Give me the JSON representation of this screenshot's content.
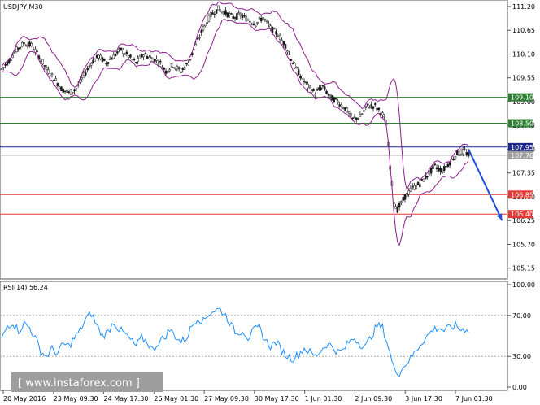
{
  "chart_data": [
    {
      "type": "candlestick",
      "title": "USDJPY,M30",
      "ylim": [
        104.9,
        111.35
      ],
      "price_ticks": [
        "111.20",
        "110.65",
        "110.10",
        "109.55",
        "109.00",
        "108.45",
        "107.90",
        "107.35",
        "106.80",
        "106.25",
        "105.70",
        "105.15"
      ],
      "x_tick_labels": [
        "20 May 2016",
        "23 May 09:30",
        "24 May 17:30",
        "26 May 01:30",
        "27 May 09:30",
        "30 May 17:30",
        "1 Jun 01:30",
        "2 Jun 09:30",
        "3 Jun 17:30",
        "7 Jun 01:30"
      ],
      "levels": [
        {
          "label": "109.10",
          "value": 109.1,
          "color": "#2e7d32",
          "kind": "resistance"
        },
        {
          "label": "108.50",
          "value": 108.5,
          "color": "#2e7d32",
          "kind": "resistance"
        },
        {
          "label": "107.95",
          "value": 107.95,
          "color": "#1f2a8a",
          "kind": "pivot"
        },
        {
          "label": "107.76",
          "value": 107.76,
          "color": "#9e9e9e",
          "kind": "current"
        },
        {
          "label": "106.85",
          "value": 106.85,
          "color": "#e53935",
          "kind": "support"
        },
        {
          "label": "106.40",
          "value": 106.4,
          "color": "#e53935",
          "kind": "support"
        }
      ],
      "close_path": [
        [
          0,
          109.75
        ],
        [
          4,
          109.95
        ],
        [
          8,
          110.2
        ],
        [
          12,
          110.35
        ],
        [
          16,
          110.3
        ],
        [
          20,
          110.05
        ],
        [
          24,
          109.75
        ],
        [
          28,
          109.55
        ],
        [
          32,
          109.3
        ],
        [
          36,
          109.2
        ],
        [
          40,
          109.3
        ],
        [
          44,
          109.6
        ],
        [
          48,
          109.9
        ],
        [
          52,
          110.05
        ],
        [
          56,
          109.9
        ],
        [
          60,
          110.05
        ],
        [
          64,
          110.2
        ],
        [
          68,
          110.05
        ],
        [
          72,
          109.9
        ],
        [
          76,
          110.1
        ],
        [
          80,
          110.0
        ],
        [
          84,
          109.95
        ],
        [
          88,
          109.7
        ],
        [
          92,
          109.85
        ],
        [
          96,
          109.7
        ],
        [
          100,
          109.9
        ],
        [
          104,
          110.3
        ],
        [
          108,
          110.7
        ],
        [
          112,
          111.0
        ],
        [
          116,
          111.15
        ],
        [
          120,
          111.05
        ],
        [
          124,
          110.95
        ],
        [
          128,
          111.0
        ],
        [
          132,
          110.9
        ],
        [
          136,
          110.8
        ],
        [
          140,
          110.95
        ],
        [
          144,
          110.7
        ],
        [
          148,
          110.55
        ],
        [
          152,
          110.3
        ],
        [
          156,
          109.9
        ],
        [
          160,
          109.6
        ],
        [
          164,
          109.35
        ],
        [
          168,
          109.2
        ],
        [
          172,
          109.35
        ],
        [
          176,
          109.1
        ],
        [
          180,
          109.0
        ],
        [
          184,
          108.85
        ],
        [
          188,
          108.6
        ],
        [
          192,
          108.65
        ],
        [
          196,
          108.9
        ],
        [
          200,
          108.9
        ],
        [
          204,
          108.7
        ],
        [
          206,
          108.5
        ],
        [
          208,
          107.5
        ],
        [
          210,
          106.7
        ],
        [
          212,
          106.5
        ],
        [
          214,
          106.65
        ],
        [
          216,
          106.8
        ],
        [
          220,
          107.0
        ],
        [
          224,
          107.1
        ],
        [
          228,
          107.3
        ],
        [
          232,
          107.5
        ],
        [
          236,
          107.4
        ],
        [
          240,
          107.6
        ],
        [
          244,
          107.8
        ],
        [
          248,
          107.85
        ],
        [
          250,
          107.76
        ]
      ],
      "forecast_arrow": {
        "from": [
          250,
          107.9
        ],
        "to": [
          268,
          106.25
        ],
        "color": "#1e4fe0"
      }
    },
    {
      "type": "line",
      "title": "RSI(14) 56.24",
      "ylim": [
        0,
        100
      ],
      "ticks": [
        "100.00",
        "70.00",
        "30.00",
        "0.00"
      ],
      "levels": [
        70,
        30
      ],
      "values": [
        [
          0,
          46
        ],
        [
          3,
          60
        ],
        [
          6,
          63
        ],
        [
          9,
          55
        ],
        [
          12,
          62
        ],
        [
          15,
          58
        ],
        [
          18,
          48
        ],
        [
          21,
          35
        ],
        [
          24,
          30
        ],
        [
          27,
          37
        ],
        [
          30,
          33
        ],
        [
          33,
          42
        ],
        [
          36,
          40
        ],
        [
          39,
          48
        ],
        [
          42,
          55
        ],
        [
          45,
          66
        ],
        [
          48,
          72
        ],
        [
          51,
          60
        ],
        [
          54,
          50
        ],
        [
          57,
          54
        ],
        [
          60,
          64
        ],
        [
          63,
          56
        ],
        [
          66,
          52
        ],
        [
          69,
          46
        ],
        [
          72,
          40
        ],
        [
          75,
          48
        ],
        [
          78,
          44
        ],
        [
          81,
          36
        ],
        [
          84,
          44
        ],
        [
          87,
          48
        ],
        [
          90,
          56
        ],
        [
          93,
          50
        ],
        [
          96,
          44
        ],
        [
          99,
          48
        ],
        [
          102,
          60
        ],
        [
          105,
          68
        ],
        [
          108,
          64
        ],
        [
          111,
          72
        ],
        [
          114,
          75
        ],
        [
          117,
          76
        ],
        [
          120,
          70
        ],
        [
          123,
          60
        ],
        [
          126,
          52
        ],
        [
          129,
          56
        ],
        [
          132,
          48
        ],
        [
          135,
          55
        ],
        [
          138,
          58
        ],
        [
          141,
          46
        ],
        [
          144,
          40
        ],
        [
          147,
          44
        ],
        [
          150,
          36
        ],
        [
          153,
          30
        ],
        [
          156,
          28
        ],
        [
          159,
          32
        ],
        [
          162,
          38
        ],
        [
          165,
          34
        ],
        [
          168,
          30
        ],
        [
          171,
          36
        ],
        [
          174,
          42
        ],
        [
          177,
          40
        ],
        [
          180,
          34
        ],
        [
          183,
          36
        ],
        [
          186,
          44
        ],
        [
          189,
          48
        ],
        [
          192,
          42
        ],
        [
          195,
          40
        ],
        [
          198,
          50
        ],
        [
          201,
          60
        ],
        [
          204,
          58
        ],
        [
          207,
          40
        ],
        [
          210,
          18
        ],
        [
          213,
          14
        ],
        [
          216,
          22
        ],
        [
          219,
          28
        ],
        [
          222,
          36
        ],
        [
          225,
          44
        ],
        [
          228,
          50
        ],
        [
          231,
          56
        ],
        [
          234,
          58
        ],
        [
          237,
          55
        ],
        [
          240,
          58
        ],
        [
          243,
          60
        ],
        [
          246,
          56
        ],
        [
          249,
          57
        ],
        [
          250,
          56
        ]
      ]
    }
  ],
  "watermark": {
    "text": "[ www.instaforex.com ]",
    "color": "#ffffff",
    "background": "#9e9e9e"
  },
  "colors": {
    "candle": "#1a1a1a",
    "bollinger": "#8e1e8e",
    "rsi": "#1e8fff",
    "level_red": "#e53935",
    "level_green": "#2e7d32"
  }
}
